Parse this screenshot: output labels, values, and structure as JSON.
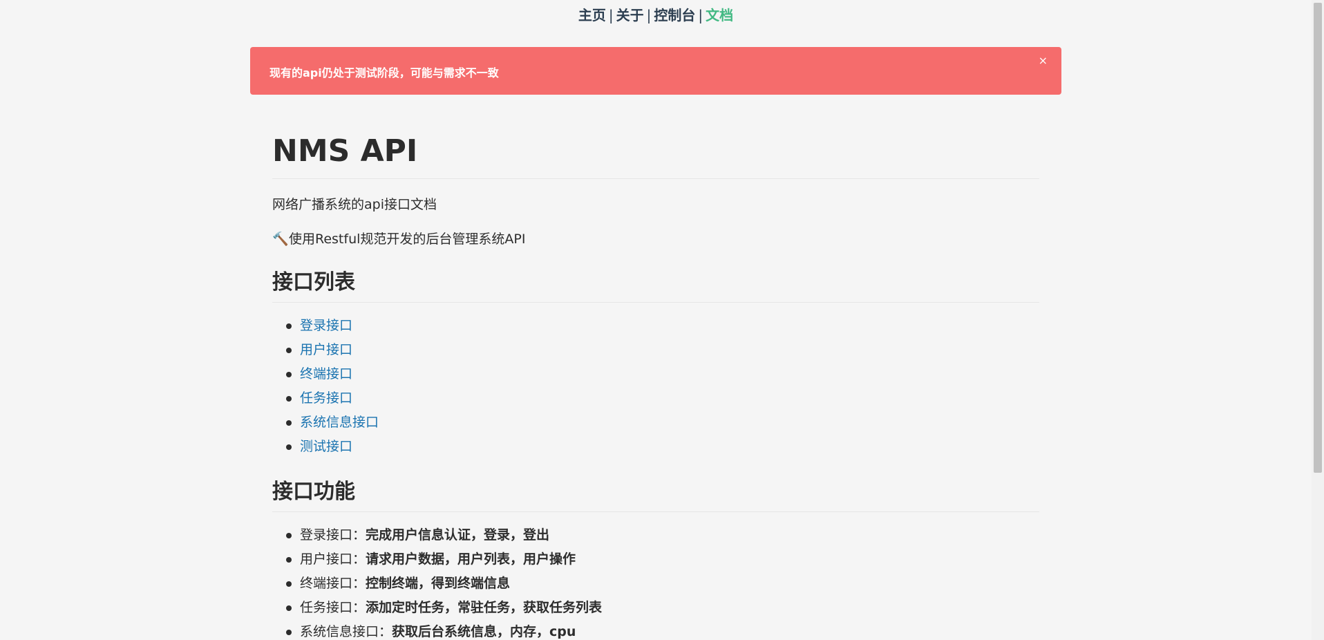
{
  "nav": {
    "items": [
      {
        "label": "主页"
      },
      {
        "label": "关于"
      },
      {
        "label": "控制台"
      },
      {
        "label": "文档"
      }
    ],
    "separator": "|",
    "active_color": "#42b983"
  },
  "alert": {
    "message": "现有的api仍处于测试阶段，可能与需求不一致",
    "close_icon": "×",
    "color": "#f56c6c"
  },
  "doc": {
    "title": "NMS API",
    "subtitle": "网络广播系统的api接口文档",
    "hammer_icon": "🔨",
    "intro": "使用Restful规范开发的后台管理系统API",
    "section_list": {
      "heading": "接口列表",
      "items": [
        "登录接口",
        "用户接口",
        "终端接口",
        "任务接口",
        "系统信息接口",
        "测试接口"
      ]
    },
    "section_func": {
      "heading": "接口功能",
      "items": [
        {
          "name": "登录接口：",
          "desc": "完成用户信息认证，登录，登出"
        },
        {
          "name": "用户接口：",
          "desc": "请求用户数据，用户列表，用户操作"
        },
        {
          "name": "终端接口：",
          "desc": "控制终端，得到终端信息"
        },
        {
          "name": "任务接口：",
          "desc": "添加定时任务，常驻任务，获取任务列表"
        },
        {
          "name": "系统信息接口：",
          "desc": "获取后台系统信息，内存，cpu"
        }
      ]
    }
  }
}
